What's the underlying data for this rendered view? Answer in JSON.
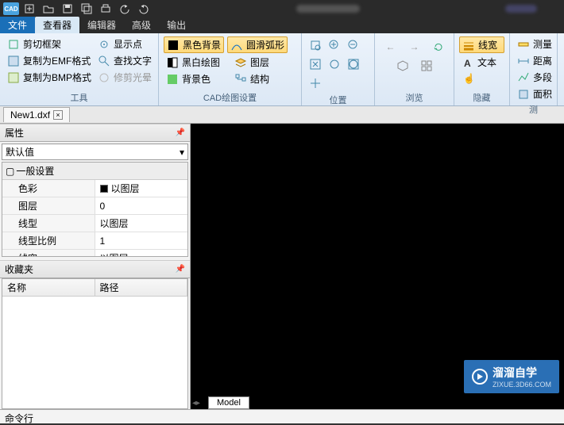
{
  "app": {
    "icon_text": "CAD"
  },
  "menu": {
    "file": "文件",
    "viewer": "查看器",
    "editor": "编辑器",
    "advanced": "高级",
    "output": "输出"
  },
  "ribbon": {
    "tools": {
      "label": "工具",
      "clip_frame": "剪切框架",
      "copy_emf": "复制为EMF格式",
      "copy_bmp": "复制为BMP格式",
      "show_point": "显示点",
      "find_text": "查找文字",
      "trim_aura": "修剪光晕"
    },
    "cad": {
      "label": "CAD绘图设置",
      "black_bg": "黑色背景",
      "smooth_arc": "圆滑弧形",
      "bw_draw": "黑白绘图",
      "layer": "图层",
      "bg_color": "背景色",
      "structure": "结构"
    },
    "position": {
      "label": "位置"
    },
    "browse": {
      "label": "浏览"
    },
    "hide": {
      "label": "隐藏",
      "linewidth": "线宽",
      "text": "文本"
    },
    "measure": {
      "label": "测",
      "measure": "测量",
      "distance": "距离",
      "multi": "多段",
      "area": "面积"
    }
  },
  "document": {
    "tab_name": "New1.dxf"
  },
  "panels": {
    "properties_title": "属性",
    "default_value": "默认值",
    "general_settings": "一般设置",
    "favorites_title": "收藏夹",
    "name_col": "名称",
    "path_col": "路径"
  },
  "props": {
    "color": {
      "label": "色彩",
      "value": "以图层"
    },
    "layer": {
      "label": "图层",
      "value": "0"
    },
    "linetype": {
      "label": "线型",
      "value": "以图层"
    },
    "ltscale": {
      "label": "线型比例",
      "value": "1"
    },
    "lineweight": {
      "label": "线宽",
      "value": "以图层"
    }
  },
  "model_tab": "Model",
  "cmd_label": "命令行",
  "watermark": {
    "brand": "溜溜自学",
    "url": "ZIXUE.3D66.COM"
  }
}
